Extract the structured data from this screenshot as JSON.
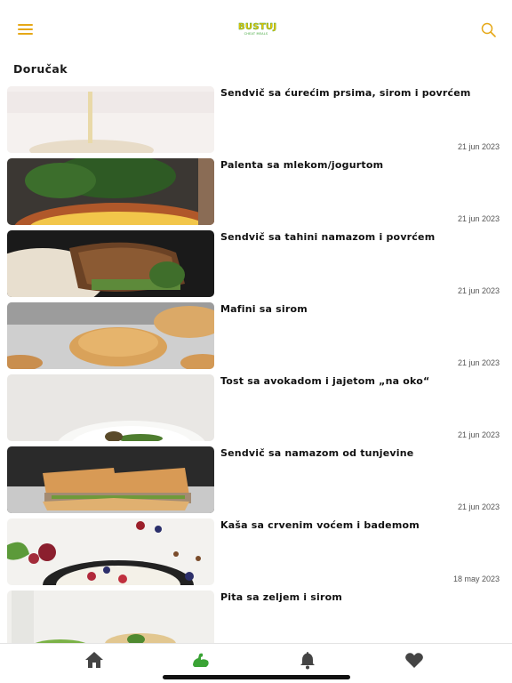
{
  "header": {
    "menu_icon": "hamburger-menu-icon",
    "logo_text": "BUSTUJ",
    "logo_subtext": "CHEAT MEALS",
    "search_icon": "search-icon",
    "accent_color": "#e6a817"
  },
  "section": {
    "title": "Doručak"
  },
  "items": [
    {
      "title": "Sendvič sa ćurećim prsima, sirom i povrćem",
      "date": "21 jun 2023"
    },
    {
      "title": "Palenta sa mlekom/jogurtom",
      "date": "21 jun 2023"
    },
    {
      "title": "Sendvič sa tahini namazom i povrćem",
      "date": "21 jun 2023"
    },
    {
      "title": "Mafini sa sirom",
      "date": "21 jun 2023"
    },
    {
      "title": "Tost sa avokadom i jajetom „na oko“",
      "date": "21 jun 2023"
    },
    {
      "title": "Sendvič sa namazom od tunjevine",
      "date": "21 jun 2023"
    },
    {
      "title": "Kaša sa crvenim voćem i bademom",
      "date": "18 may 2023"
    },
    {
      "title": "Pita sa zeljem i sirom",
      "date": ""
    }
  ],
  "tabbar": {
    "tabs": [
      {
        "icon": "home-icon",
        "active": false
      },
      {
        "icon": "flexed-arm-icon",
        "active": true
      },
      {
        "icon": "bell-icon",
        "active": false
      },
      {
        "icon": "heart-icon",
        "active": false
      }
    ],
    "active_color": "#3aa335",
    "inactive_color": "#444444"
  }
}
